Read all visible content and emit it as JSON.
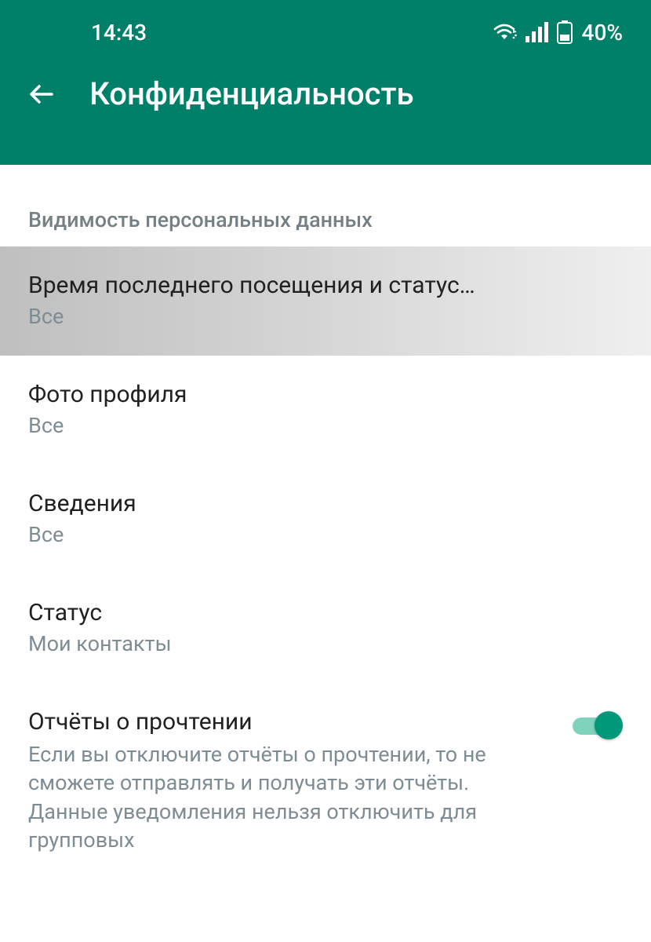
{
  "status": {
    "time": "14:43",
    "battery_pct": "40%"
  },
  "header": {
    "title": "Конфиденциальность"
  },
  "section_header": "Видимость персональных данных",
  "settings": [
    {
      "title": "Время последнего посещения и статус…",
      "value": "Все",
      "highlighted": true
    },
    {
      "title": "Фото профиля",
      "value": "Все"
    },
    {
      "title": "Сведения",
      "value": "Все"
    },
    {
      "title": "Статус",
      "value": "Мои контакты"
    }
  ],
  "read_receipts": {
    "title": "Отчёты о прочтении",
    "description": "Если вы отключите отчёты о прочтении, то не сможете отправлять и получать эти отчёты. Данные уведомления нельзя отключить для групповых",
    "enabled": true
  }
}
